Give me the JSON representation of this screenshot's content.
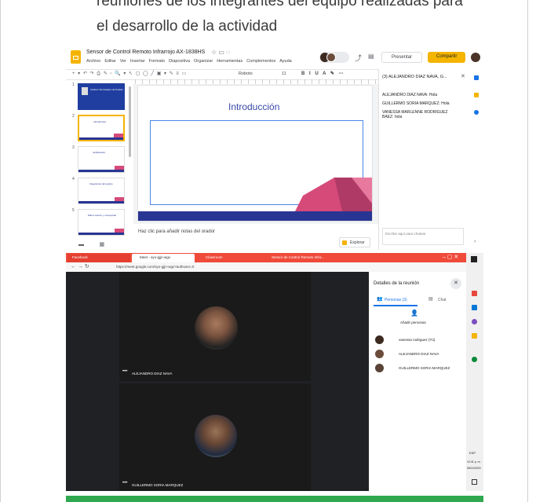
{
  "document": {
    "paragraph_lines": [
      "reuniones de los integrantes del equipo realizadas para",
      "el desarrollo de la actividad"
    ]
  },
  "slides_app": {
    "title": "Sensor de Control Remoto Infrarrojo AX-1838HS",
    "menu": [
      "Archivo",
      "Editar",
      "Ver",
      "Insertar",
      "Formato",
      "Diapositiva",
      "Organizar",
      "Herramientas",
      "Complementos",
      "Ayuda"
    ],
    "present_label": "Presentar",
    "share_label": "Compartir",
    "font_name": "Roboto",
    "font_size": "11",
    "slide_title": "Introducción",
    "speaker_notes_placeholder": "Haz clic para añadir notas del orador",
    "explore_label": "Explorar",
    "thumbnails": [
      {
        "num": "1",
        "title": "Instituto Tecnológico de Puebla"
      },
      {
        "num": "2",
        "title": "Introducción"
      },
      {
        "num": "3",
        "title": "Justificación"
      },
      {
        "num": "4",
        "title": "Integrantes del equipo"
      },
      {
        "num": "5",
        "title": "Marco teórico y conceptual"
      }
    ],
    "chat": {
      "header": "(3) ALEJANDRO DIAZ NAVA, G...",
      "messages": [
        "ALEJANDRO DIAZ NAVA: Hola",
        "GUILLERMO SORIA MARQUEZ: Hola",
        "VANESSA MARLENNE RODRIGUEZ BAEZ: hola"
      ],
      "input_placeholder": "Escribe aquí para chatear"
    },
    "colors": {
      "accent": "#f4b400",
      "slide_blue": "#283593",
      "slide_pink": "#d64a7a",
      "selection": "#4a86e8"
    }
  },
  "meet_app": {
    "tabs": [
      "Facebook",
      "Meet - syo-gjjn-wgx",
      "Classroom",
      "Sensor de Control Remoto Infra..."
    ],
    "url": "https://meet.google.com/syo-gjjn-wgx?authuser=0",
    "panel_title": "Detalles de la reunión",
    "people_tab": "Personas (3)",
    "chat_tab": "Chat",
    "add_people": "Añadir personas",
    "participants": [
      "vanessa rodriguez (Tú)",
      "ALEJANDRO DIAZ NAVA",
      "GUILLERMO SORIA MARQUEZ"
    ],
    "tiles": [
      {
        "name": "ALEJANDRO DIAZ NAVA"
      },
      {
        "name": "GUILLERMO SORIA MARQUEZ"
      }
    ],
    "taskbar": {
      "lang": "ESP",
      "time": "12:41 p. m.",
      "date": "06/10/2020"
    },
    "colors": {
      "tab_bar": "#f04a3a",
      "people_accent": "#1a73e8"
    }
  }
}
